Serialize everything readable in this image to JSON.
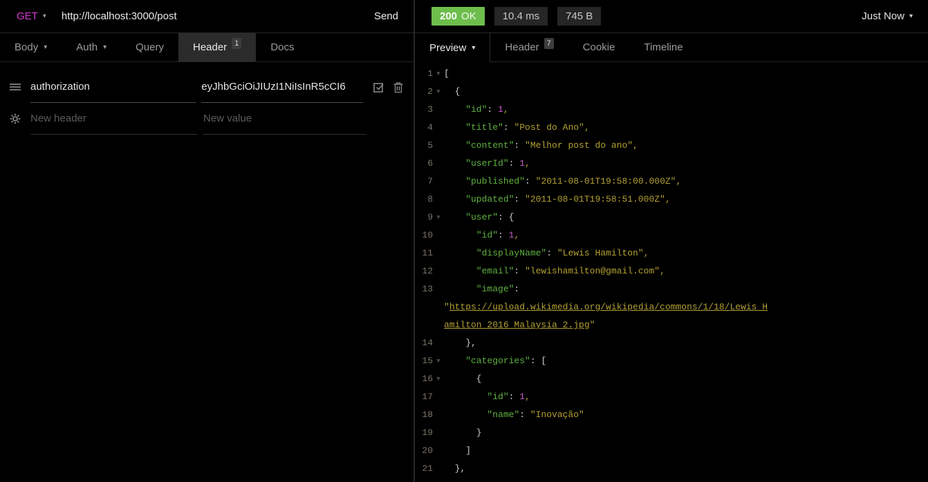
{
  "request": {
    "method": "GET",
    "url": "http://localhost:3000/post",
    "send_label": "Send",
    "tabs": [
      {
        "label": "Body",
        "caret": true
      },
      {
        "label": "Auth",
        "caret": true
      },
      {
        "label": "Query"
      },
      {
        "label": "Header",
        "badge": "1",
        "active": true
      },
      {
        "label": "Docs"
      }
    ],
    "headers": {
      "rows": [
        {
          "name": "authorization",
          "value": "eyJhbGciOiJIUzI1NiIsInR5cCI6",
          "enabled": true
        }
      ],
      "new_name_placeholder": "New header",
      "new_value_placeholder": "New value"
    }
  },
  "response": {
    "status_code": "200",
    "status_text": "OK",
    "time": "10.4 ms",
    "size": "745 B",
    "when": "Just Now",
    "tabs": [
      {
        "label": "Preview",
        "caret": true,
        "active": true
      },
      {
        "label": "Header",
        "badge": "7"
      },
      {
        "label": "Cookie"
      },
      {
        "label": "Timeline"
      }
    ],
    "body_lines": [
      {
        "n": "1",
        "fold": true,
        "t": [
          [
            "p",
            "["
          ]
        ]
      },
      {
        "n": "2",
        "fold": true,
        "t": [
          [
            "p",
            "  {"
          ]
        ]
      },
      {
        "n": "3",
        "t": [
          [
            "k",
            "    \"id\""
          ],
          [
            "p",
            ": "
          ],
          [
            "n",
            "1"
          ],
          [
            "s",
            ","
          ]
        ]
      },
      {
        "n": "4",
        "t": [
          [
            "k",
            "    \"title\""
          ],
          [
            "p",
            ": "
          ],
          [
            "s",
            "\"Post do Ano\","
          ]
        ]
      },
      {
        "n": "5",
        "t": [
          [
            "k",
            "    \"content\""
          ],
          [
            "p",
            ": "
          ],
          [
            "s",
            "\"Melhor post do ano\","
          ]
        ]
      },
      {
        "n": "6",
        "t": [
          [
            "k",
            "    \"userId\""
          ],
          [
            "p",
            ": "
          ],
          [
            "n",
            "1"
          ],
          [
            "s",
            ","
          ]
        ]
      },
      {
        "n": "7",
        "t": [
          [
            "k",
            "    \"published\""
          ],
          [
            "p",
            ": "
          ],
          [
            "s",
            "\"2011-08-01T19:58:00.000Z\","
          ]
        ]
      },
      {
        "n": "8",
        "t": [
          [
            "k",
            "    \"updated\""
          ],
          [
            "p",
            ": "
          ],
          [
            "s",
            "\"2011-08-01T19:58:51.000Z\","
          ]
        ]
      },
      {
        "n": "9",
        "fold": true,
        "t": [
          [
            "k",
            "    \"user\""
          ],
          [
            "p",
            ": {"
          ]
        ]
      },
      {
        "n": "10",
        "t": [
          [
            "k",
            "      \"id\""
          ],
          [
            "p",
            ": "
          ],
          [
            "n",
            "1"
          ],
          [
            "s",
            ","
          ]
        ]
      },
      {
        "n": "11",
        "t": [
          [
            "k",
            "      \"displayName\""
          ],
          [
            "p",
            ": "
          ],
          [
            "s",
            "\"Lewis Hamilton\","
          ]
        ]
      },
      {
        "n": "12",
        "t": [
          [
            "k",
            "      \"email\""
          ],
          [
            "p",
            ": "
          ],
          [
            "s",
            "\"lewishamilton@gmail.com\","
          ]
        ]
      },
      {
        "n": "13",
        "t": [
          [
            "k",
            "      \"image\""
          ],
          [
            "p",
            ":"
          ]
        ]
      },
      {
        "n": "",
        "t": [
          [
            "s",
            "\""
          ],
          [
            "l",
            "https://upload.wikimedia.org/wikipedia/commons/1/18/Lewis_H"
          ]
        ]
      },
      {
        "n": "",
        "t": [
          [
            "l",
            "amilton_2016_Malaysia_2.jpg"
          ],
          [
            "s",
            "\""
          ]
        ]
      },
      {
        "n": "14",
        "t": [
          [
            "p",
            "    },"
          ]
        ]
      },
      {
        "n": "15",
        "fold": true,
        "t": [
          [
            "k",
            "    \"categories\""
          ],
          [
            "p",
            ": ["
          ]
        ]
      },
      {
        "n": "16",
        "fold": true,
        "t": [
          [
            "p",
            "      {"
          ]
        ]
      },
      {
        "n": "17",
        "t": [
          [
            "k",
            "        \"id\""
          ],
          [
            "p",
            ": "
          ],
          [
            "n",
            "1"
          ],
          [
            "s",
            ","
          ]
        ]
      },
      {
        "n": "18",
        "t": [
          [
            "k",
            "        \"name\""
          ],
          [
            "p",
            ": "
          ],
          [
            "s",
            "\"Inovação\""
          ]
        ]
      },
      {
        "n": "19",
        "t": [
          [
            "p",
            "      }"
          ]
        ]
      },
      {
        "n": "20",
        "t": [
          [
            "p",
            "    ]"
          ]
        ]
      },
      {
        "n": "21",
        "t": [
          [
            "p",
            "  },"
          ]
        ]
      }
    ]
  },
  "colors": {
    "method_get": "#d93ad2",
    "status_ok_bg": "#6ebe4c",
    "json_key": "#5fb241",
    "json_string": "#b3a132",
    "json_number": "#c75bc7",
    "json_punctuation": "#cdcdcd"
  },
  "icons": {
    "drag_handle": "drag-handle-icon",
    "gear": "gear-icon",
    "checkbox_checked": "checkbox-checked-icon",
    "trash": "trash-icon",
    "chevron": "chevron-down-icon",
    "fold": "fold-arrow-icon"
  }
}
